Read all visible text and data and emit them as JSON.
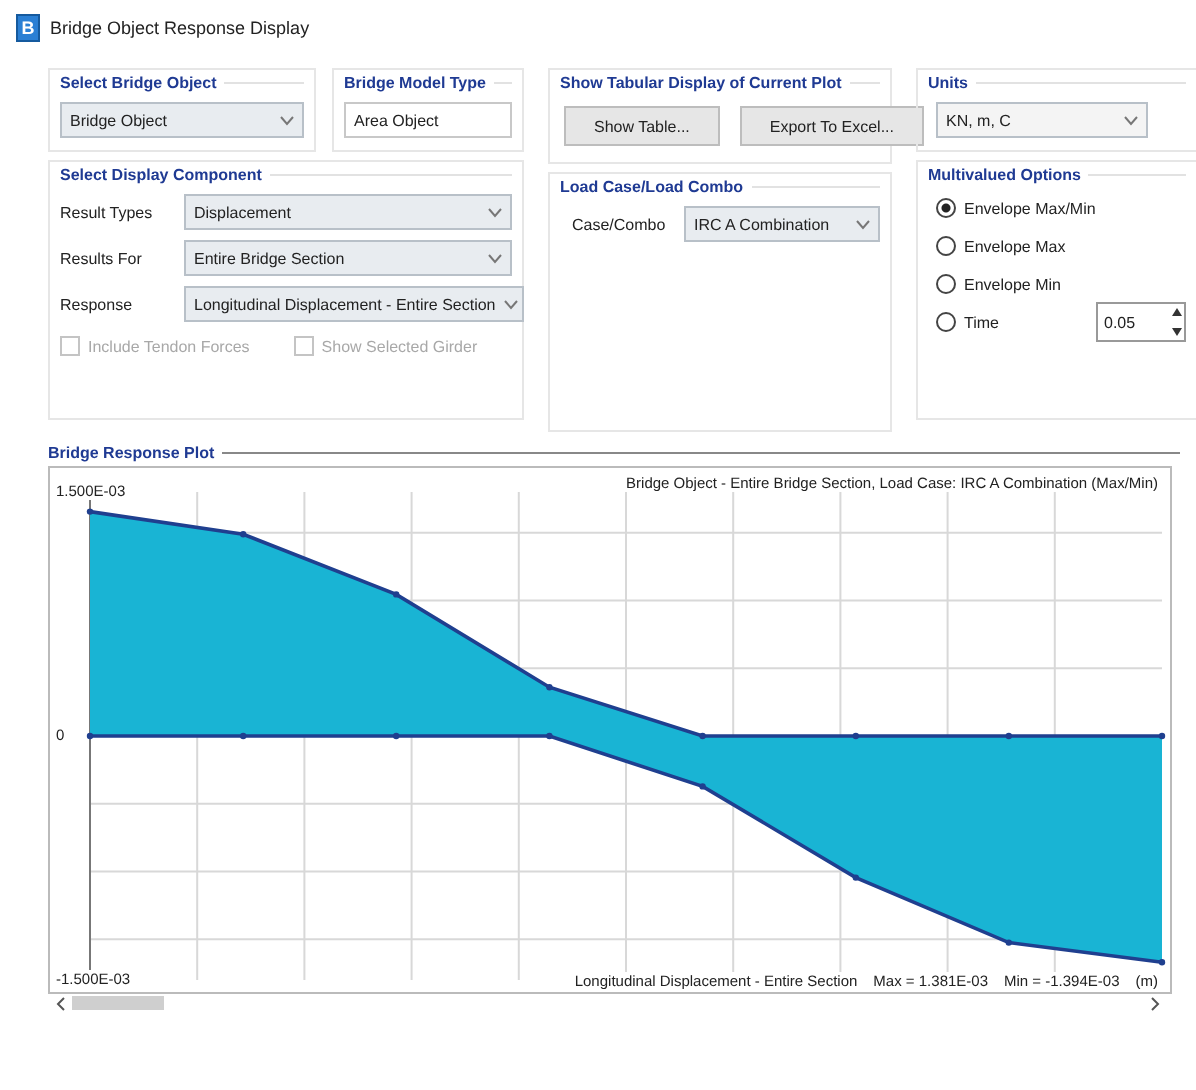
{
  "window": {
    "app_badge": "B",
    "title": "Bridge Object Response Display"
  },
  "select_bridge_object": {
    "label": "Select Bridge Object",
    "value": "Bridge Object"
  },
  "bridge_model_type": {
    "label": "Bridge Model Type",
    "value": "Area Object"
  },
  "tabular_display": {
    "label": "Show Tabular Display of Current Plot",
    "buttons": [
      "Show Table...",
      "Export To Excel..."
    ]
  },
  "units": {
    "label": "Units",
    "value": "KN, m, C"
  },
  "display_component": {
    "label": "Select Display Component",
    "rows": [
      {
        "label": "Result Types",
        "value": "Displacement"
      },
      {
        "label": "Results For",
        "value": "Entire Bridge Section"
      },
      {
        "label": "Response",
        "value": "Longitudinal Displacement - Entire Section"
      }
    ],
    "checkboxes": [
      {
        "label": "Include Tendon Forces",
        "checked": false,
        "disabled": true
      },
      {
        "label": "Show Selected Girder",
        "checked": false,
        "disabled": true
      }
    ]
  },
  "load_case": {
    "label": "Load Case/Load Combo",
    "rows": [
      {
        "label": "Case/Combo",
        "value": "IRC A Combination"
      }
    ]
  },
  "multivalued_options": {
    "label": "Multivalued Options",
    "options": [
      {
        "label": "Envelope Max/Min",
        "selected": true
      },
      {
        "label": "Envelope Max",
        "selected": false
      },
      {
        "label": "Envelope Min",
        "selected": false
      },
      {
        "label": "Time",
        "selected": false,
        "value": "0.05"
      }
    ]
  },
  "plot": {
    "label": "Bridge Response Plot",
    "chart_data": {
      "type": "area",
      "title": "Bridge Object - Entire Bridge Section, Load Case: IRC A Combination (Max/Min)",
      "xlabel": "Longitudinal Displacement - Entire Section",
      "ylim": [
        -0.0015,
        0.0015
      ],
      "yticks": [
        {
          "value": 0.0015,
          "label": "1.500E-03"
        },
        {
          "value": 0,
          "label": "0"
        },
        {
          "value": -0.0015,
          "label": "-1.500E-03"
        }
      ],
      "series": [
        {
          "color": "#19b4d4",
          "values": [
            0.00138,
            0.00124,
            0.00087,
            0.0003,
            0,
            0,
            0,
            0
          ]
        },
        {
          "color": "#19b4d4",
          "values": [
            0,
            0,
            0,
            0,
            -0.00031,
            -0.00087,
            -0.00127,
            -0.00139
          ]
        }
      ],
      "annotations": [
        "Max = 1.381E-03",
        "Min = -1.394E-03",
        "(m)"
      ]
    }
  }
}
